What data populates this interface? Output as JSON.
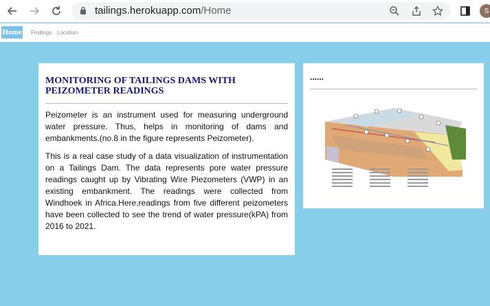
{
  "browser": {
    "url_host": "tailings.herokuapp.com",
    "url_path": "/Home",
    "avatar_letter": "S"
  },
  "sitenav": {
    "home": "Home",
    "findings": "Findings",
    "location": "Location"
  },
  "main": {
    "title": "MONITORING OF TAILINGS DAMS WITH PEIZOMETER READINGS",
    "para1": "Peizometer is an instrument used for measuring underground water pressure. Thus, helps in monitoring of dams and embankments.(no.8 in the figure represents Peizometer).",
    "para2": "This is a real case study of a data visualization of instrumentation on a Tailings Dam. The data represents pore water pressure readings caught up by Vibrating Wire Piezometers (VWP) in an existing embankment. The readings were collected from Windhoek in Africa.Here,readings from five different peizometers have been collected to see the trend of water pressure(kPA) from 2016 to 2021."
  },
  "side": {
    "heading": "......"
  },
  "colors": {
    "page_bg": "#87ceeb",
    "home_bg": "#7ec3e6",
    "title": "#1a1a6e"
  }
}
